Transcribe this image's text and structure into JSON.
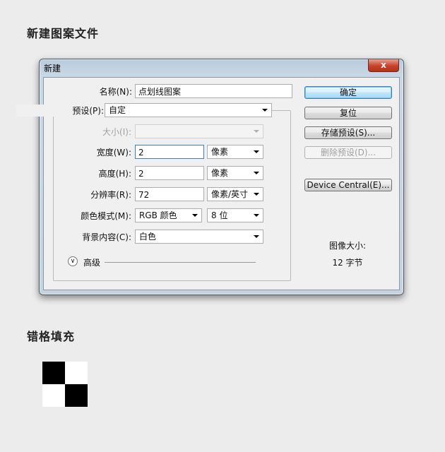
{
  "page": {
    "heading_new_file": "新建图案文件",
    "heading_pattern_fill": "错格填充"
  },
  "dialog": {
    "title": "新建",
    "close_glyph": "x",
    "name_label": "名称(N):",
    "name_value": "点划线图案",
    "preset_label": "预设(P):",
    "preset_value": "自定",
    "size_label": "大小(I):",
    "size_value": "",
    "width_label": "宽度(W):",
    "width_value": "2",
    "width_unit": "像素",
    "height_label": "高度(H):",
    "height_value": "2",
    "height_unit": "像素",
    "resolution_label": "分辨率(R):",
    "resolution_value": "72",
    "resolution_unit": "像素/英寸",
    "color_mode_label": "颜色模式(M):",
    "color_mode_value": "RGB 颜色",
    "bit_depth_value": "8 位",
    "background_label": "背景内容(C):",
    "background_value": "白色",
    "advanced_label": "高级",
    "buttons": {
      "ok": "确定",
      "reset": "复位",
      "save_preset": "存储预设(S)...",
      "delete_preset": "删除预设(D)...",
      "device_central": "Device Central(E)..."
    },
    "image_size_label": "图像大小:",
    "image_size_value": "12 字节"
  },
  "pattern": {
    "black": "#000000",
    "white": "#ffffff"
  }
}
